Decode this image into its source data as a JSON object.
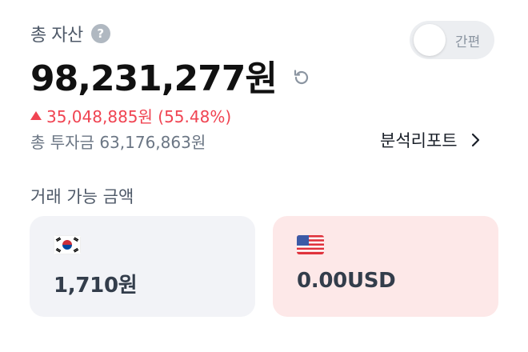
{
  "header": {
    "total_label": "총 자산",
    "help_icon_glyph": "?",
    "toggle_label": "간편",
    "total_value": "98,231,277원"
  },
  "profit": {
    "text": "35,048,885원 (55.48%)",
    "direction": "up",
    "color": "#f04452"
  },
  "investment": {
    "text": "총 투자금 63,176,863원"
  },
  "report": {
    "label": "분석리포트"
  },
  "available": {
    "title": "거래 가능 금액",
    "cards": [
      {
        "currency_icon": "korea-flag-icon",
        "value": "1,710원",
        "bg": "#f2f3f7"
      },
      {
        "currency_icon": "usa-flag-icon",
        "value": "0.00USD",
        "bg": "#fde8e8"
      }
    ]
  }
}
